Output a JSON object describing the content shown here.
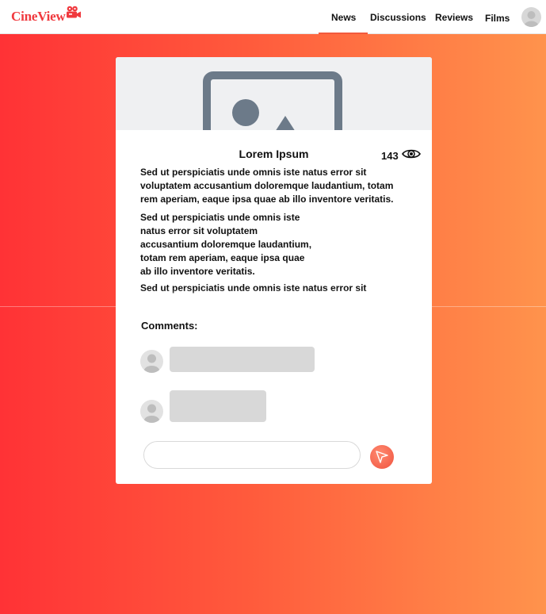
{
  "header": {
    "logo_text": "CineView",
    "nav": {
      "news": "News",
      "discussions": "Discussions",
      "reviews": "Reviews",
      "films": "Films"
    },
    "active_tab": "News"
  },
  "article": {
    "title": "Lorem Ipsum",
    "views": "143",
    "paragraphs": [
      [
        "Sed ut perspiciatis unde omnis iste natus error sit",
        "voluptatem accusantium doloremque laudantium, totam",
        "rem aperiam, eaque ipsa quae ab illo inventore veritatis."
      ],
      [
        "Sed ut perspiciatis unde omnis iste",
        "natus error sit voluptatem",
        "accusantium doloremque laudantium,",
        "totam rem aperiam, eaque ipsa quae",
        "ab illo inventore veritatis."
      ],
      [
        "Sed ut perspiciatis unde omnis iste natus error sit"
      ]
    ]
  },
  "comments": {
    "title": "Comments:",
    "input_placeholder": ""
  },
  "colors": {
    "brand": "#f0393e",
    "gradient_start": "#ff3236",
    "gradient_end": "#ff934c",
    "send_button": "#f0533f"
  },
  "icons": [
    "camera-icon",
    "user-avatar-icon",
    "image-placeholder-icon",
    "eye-icon",
    "send-icon"
  ]
}
